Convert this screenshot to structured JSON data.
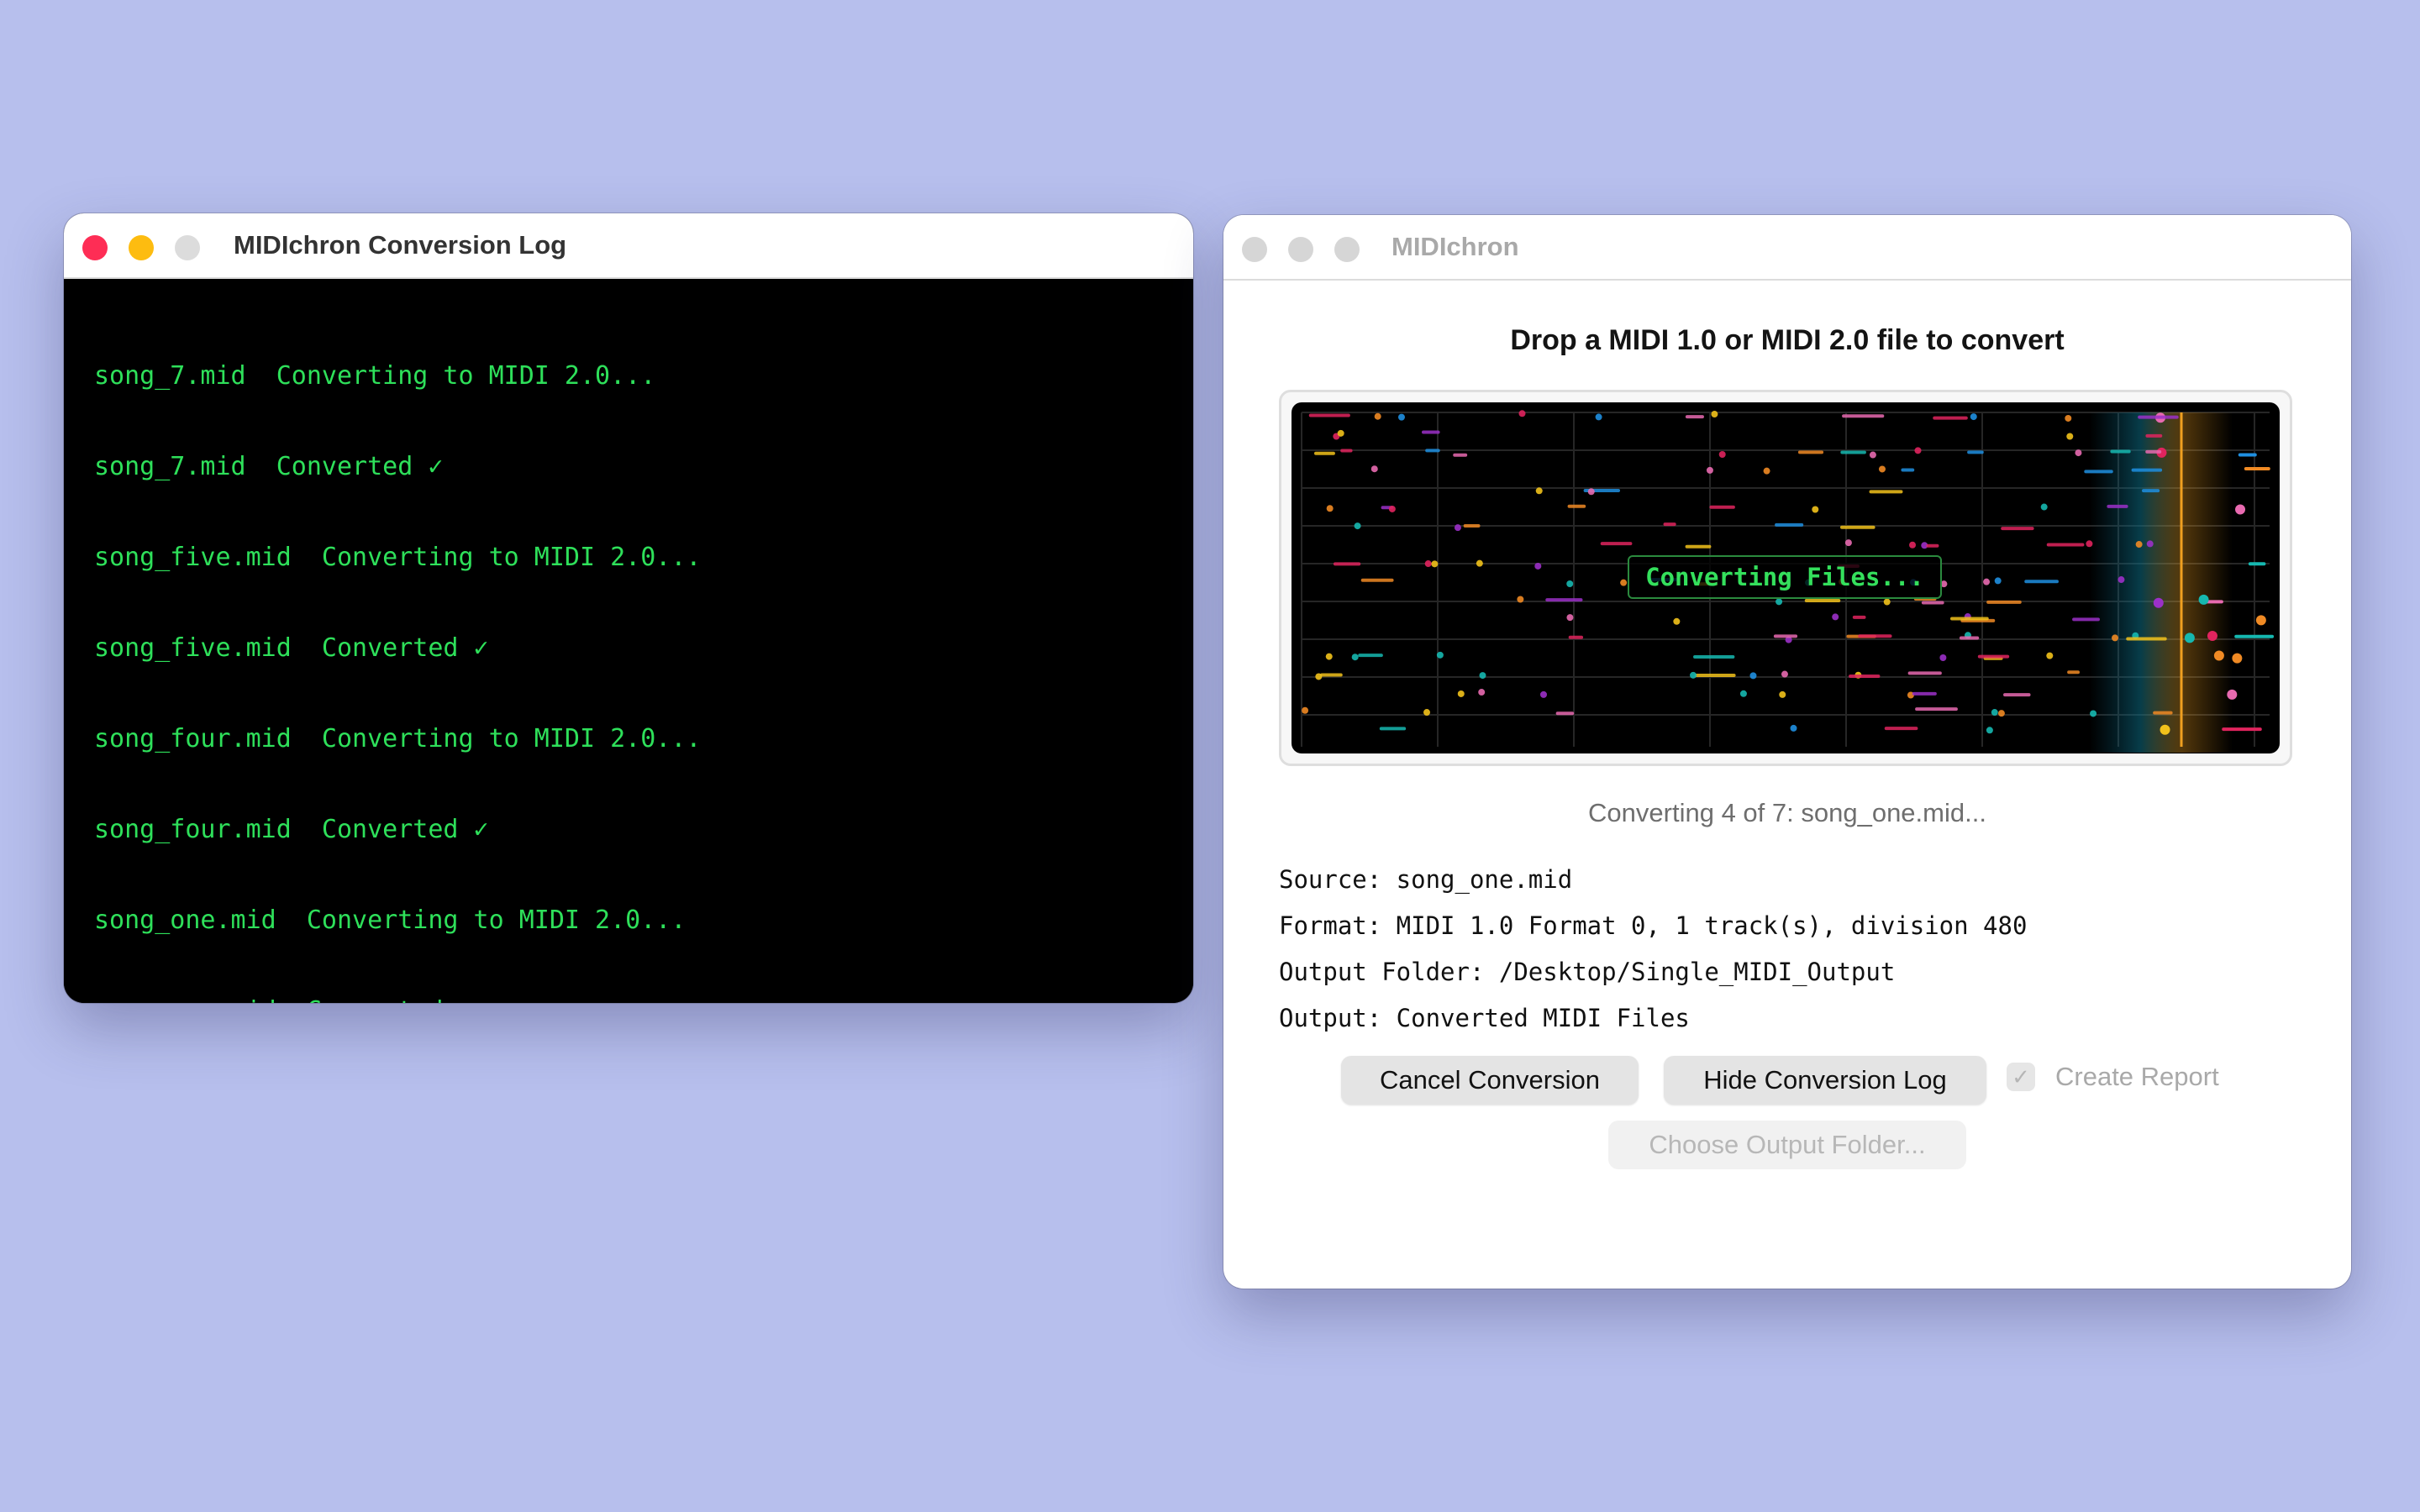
{
  "log_window": {
    "title": "MIDIchron Conversion Log",
    "lines": [
      "song_7.mid  Converting to MIDI 2.0...",
      "song_7.mid  Converted ✓",
      "song_five.mid  Converting to MIDI 2.0...",
      "song_five.mid  Converted ✓",
      "song_four.mid  Converting to MIDI 2.0...",
      "song_four.mid  Converted ✓",
      "song_one.mid  Converting to MIDI 2.0...",
      "song_one.mid  Converted ✓"
    ],
    "text_color": "#2ee05a"
  },
  "main_window": {
    "title": "MIDIchron",
    "heading": "Drop a MIDI 1.0 or MIDI 2.0 file to convert",
    "visualizer": {
      "badge": "Converting Files...",
      "note_colors": [
        "#e0245e",
        "#f08a24",
        "#9b30c8",
        "#1f8fe0",
        "#16b8b0",
        "#f2c21b",
        "#e86ab0"
      ],
      "playhead_color": "#f0a020"
    },
    "status": "Converting 4 of 7: song_one.mid...",
    "info": {
      "source": "Source: song_one.mid",
      "format": "Format: MIDI 1.0 Format 0, 1 track(s), division 480",
      "output_folder": "Output Folder: /Desktop/Single_MIDI_Output",
      "output": "Output: Converted MIDI Files"
    },
    "buttons": {
      "cancel": "Cancel Conversion",
      "hide_log": "Hide Conversion Log",
      "create_report": "Create Report",
      "choose_folder": "Choose Output Folder..."
    }
  },
  "traffic_lights": {
    "close": "#fe2d55",
    "minimize": "#fdbc10",
    "zoom": "#dcdcdc",
    "inactive": "#d6d6d6"
  }
}
